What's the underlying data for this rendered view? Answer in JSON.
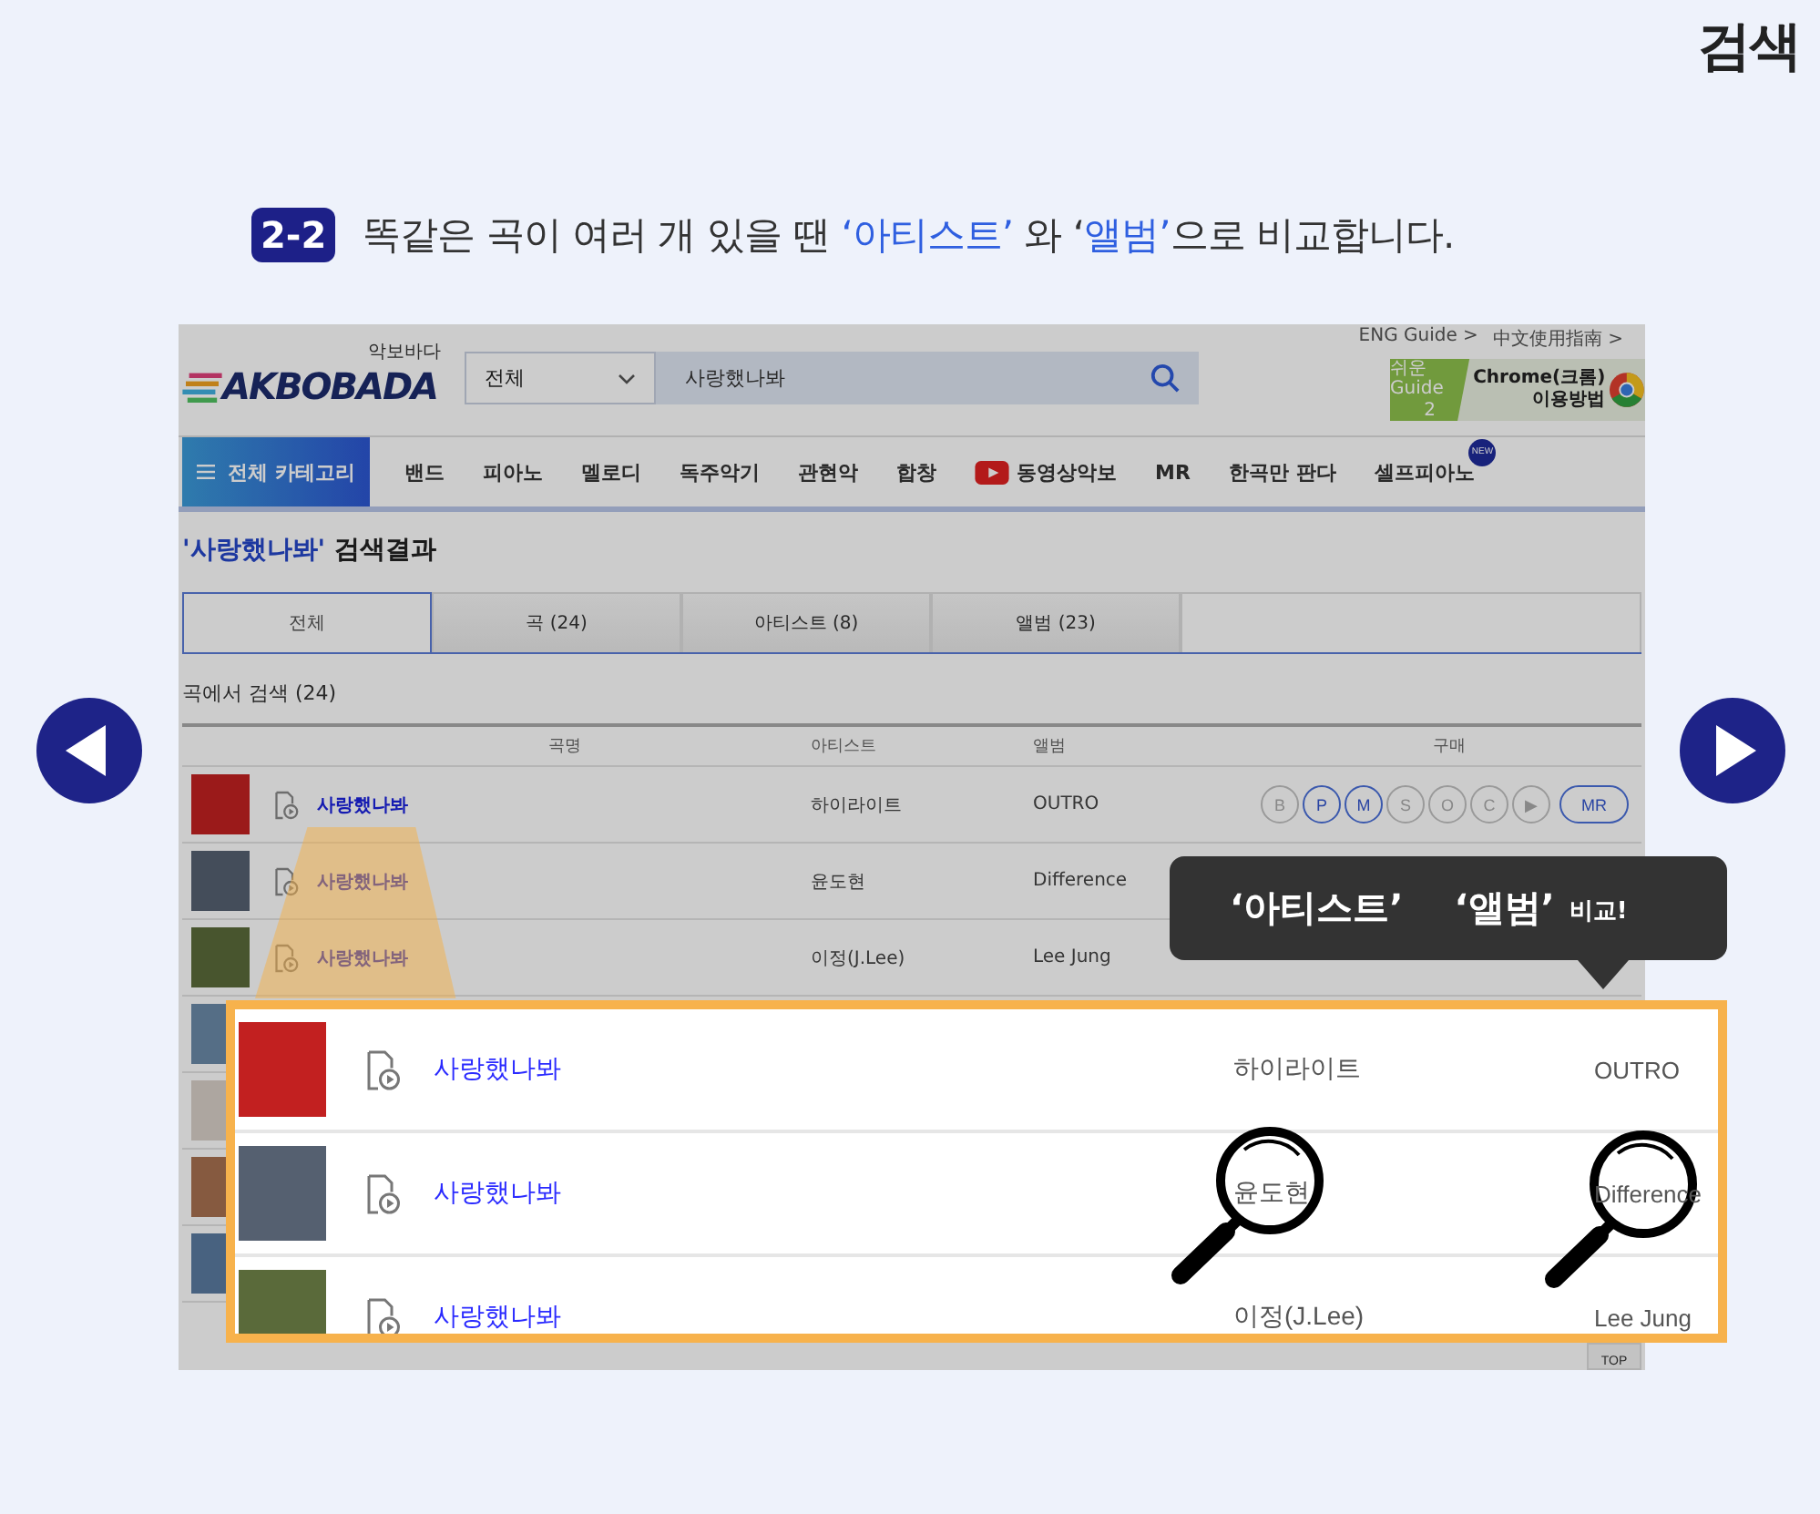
{
  "corner_title": "검색",
  "instruction": {
    "step": "2-2",
    "parts": [
      {
        "text": "똑같은 곡이 여러 개 있을 땐 ",
        "highlight": false
      },
      {
        "text": "‘아티스트’",
        "highlight": true
      },
      {
        "text": " 와 ‘",
        "highlight": false
      },
      {
        "text": "앨범’",
        "highlight": true
      },
      {
        "text": "으로 비교합니다.",
        "highlight": false
      }
    ]
  },
  "site": {
    "logo": {
      "tagline": "악보바다",
      "name": "AKBOBADA"
    },
    "search": {
      "category": "전체",
      "query": "사랑했나봐"
    },
    "top_links": [
      "ENG Guide >",
      "中文使用指南 >"
    ],
    "guide_banner": {
      "label_lines": [
        "쉬운 Guide",
        "2"
      ],
      "title": "Chrome(크롬)",
      "subtitle": "이용방법"
    },
    "category_button": "전체 카테고리",
    "menu": [
      {
        "label": "밴드",
        "kind": "plain"
      },
      {
        "label": "피아노",
        "kind": "plain"
      },
      {
        "label": "멜로디",
        "kind": "plain"
      },
      {
        "label": "독주악기",
        "kind": "plain"
      },
      {
        "label": "관현악",
        "kind": "plain"
      },
      {
        "label": "합창",
        "kind": "plain"
      },
      {
        "label": "동영상악보",
        "kind": "video"
      },
      {
        "label": "MR",
        "kind": "plain"
      },
      {
        "label": "한곡만 판다",
        "kind": "plain"
      },
      {
        "label": "셀프피아노",
        "kind": "new",
        "badge": "NEW"
      }
    ],
    "results_title": [
      {
        "text": "'사랑했나봐'",
        "highlight": true
      },
      {
        "text": " 검색결과",
        "highlight": false
      }
    ],
    "tabs": [
      {
        "label": "전체",
        "selected": true
      },
      {
        "label": "곡 (24)",
        "selected": false
      },
      {
        "label": "아티스트 (8)",
        "selected": false
      },
      {
        "label": "앨범 (23)",
        "selected": false
      }
    ],
    "section_title": "곡에서 검색 (24)",
    "table": {
      "columns": [
        "곡명",
        "아티스트",
        "앨범",
        "구매"
      ],
      "rows": [
        {
          "title": "사랑했나봐",
          "artist": "하이라이트",
          "album": "OUTRO",
          "purchase": [
            {
              "label": "B",
              "available": false
            },
            {
              "label": "P",
              "available": true
            },
            {
              "label": "M",
              "available": true
            },
            {
              "label": "S",
              "available": false
            },
            {
              "label": "O",
              "available": false
            },
            {
              "label": "C",
              "available": false
            },
            {
              "label": "▶",
              "available": false
            },
            {
              "label": "MR",
              "available": true
            }
          ]
        },
        {
          "title": "사랑했나봐",
          "artist": "윤도현",
          "album": "Difference",
          "purchase": []
        },
        {
          "title": "사랑했나봐",
          "artist": "이정(J.Lee)",
          "album": "Lee Jung",
          "purchase": []
        }
      ]
    },
    "top_button": "TOP"
  },
  "callout": [
    {
      "text": "‘아티스트’",
      "kind": "emphasis"
    },
    {
      "text": "‘앨범’",
      "kind": "emphasis"
    },
    {
      "text": "비교!",
      "kind": "note"
    }
  ],
  "zoom_rows": [
    {
      "title": "사랑했나봐",
      "artist": "하이라이트",
      "album": "OUTRO",
      "magnified": false
    },
    {
      "title": "사랑했나봐",
      "artist": "윤도현",
      "album": "Difference",
      "magnified": true
    },
    {
      "title": "사랑했나봐",
      "artist": "이정(J.Lee)",
      "album": "Lee Jung",
      "magnified": false
    }
  ]
}
